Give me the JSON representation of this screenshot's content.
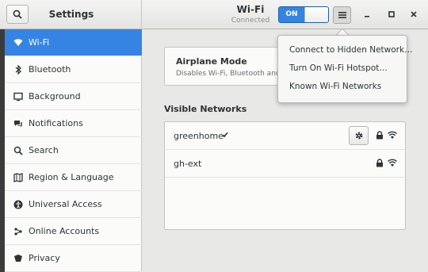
{
  "header": {
    "settings_title": "Settings",
    "wifi_title": "Wi-Fi",
    "wifi_status": "Connected",
    "toggle_label": "ON",
    "menu_icon": "hamburger-icon",
    "window_buttons": [
      "minimize",
      "maximize",
      "close"
    ]
  },
  "sidebar": {
    "items": [
      {
        "label": "Wi-Fi",
        "icon": "wifi-icon",
        "active": true
      },
      {
        "label": "Bluetooth",
        "icon": "bluetooth-icon"
      },
      {
        "label": "Background",
        "icon": "background-icon"
      },
      {
        "label": "Notifications",
        "icon": "notifications-icon"
      },
      {
        "label": "Search",
        "icon": "search-icon"
      },
      {
        "label": "Region & Language",
        "icon": "region-icon"
      },
      {
        "label": "Universal Access",
        "icon": "accessibility-icon"
      },
      {
        "label": "Online Accounts",
        "icon": "online-accounts-icon"
      },
      {
        "label": "Privacy",
        "icon": "privacy-icon"
      }
    ]
  },
  "airplane": {
    "title": "Airplane Mode",
    "description": "Disables Wi-Fi, Bluetooth and m"
  },
  "networks": {
    "heading": "Visible Networks",
    "items": [
      {
        "name": "greenhome",
        "connected_mark": "✔"
      },
      {
        "name": "gh-ext",
        "connected_mark": ""
      }
    ]
  },
  "menu": {
    "items": [
      "Connect to Hidden Network…",
      "Turn On Wi-Fi Hotspot…",
      "Known Wi-Fi Networks"
    ]
  },
  "colors": {
    "accent": "#3584e4",
    "sidebar_bg": "#fbfbfa",
    "content_bg": "#e8e8e7"
  }
}
